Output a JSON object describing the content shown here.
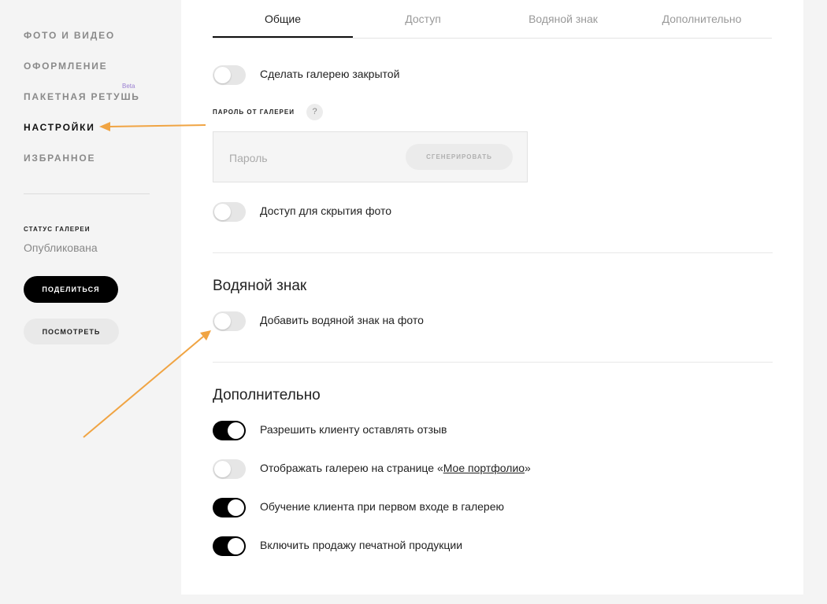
{
  "sidebar": {
    "items": [
      {
        "label": "ФОТО И ВИДЕО"
      },
      {
        "label": "ОФОРМЛЕНИЕ"
      },
      {
        "label": "ПАКЕТНАЯ РЕТУШЬ"
      },
      {
        "label": "НАСТРОЙКИ"
      },
      {
        "label": "ИЗБРАННОЕ"
      }
    ],
    "beta": "Beta",
    "status_label": "СТАТУС ГАЛЕРЕИ",
    "status_value": "Опубликована",
    "share_button": "ПОДЕЛИТЬСЯ",
    "view_button": "ПОСМОТРЕТЬ"
  },
  "tabs": [
    {
      "label": "Общие"
    },
    {
      "label": "Доступ"
    },
    {
      "label": "Водяной знак"
    },
    {
      "label": "Дополнительно"
    }
  ],
  "access": {
    "close_gallery": {
      "label": "Сделать галерею закрытой",
      "on": false
    },
    "password_label": "ПАРОЛЬ ОТ ГАЛЕРЕИ",
    "help": "?",
    "password_placeholder": "Пароль",
    "generate_button": "СГЕНЕРИРОВАТЬ",
    "hide_photos": {
      "label": "Доступ для скрытия фото",
      "on": false
    }
  },
  "watermark": {
    "title": "Водяной знак",
    "add_watermark": {
      "label": "Добавить водяной знак на фото",
      "on": false
    }
  },
  "extra": {
    "title": "Дополнительно",
    "review": {
      "label": "Разрешить клиенту оставлять отзыв",
      "on": true
    },
    "portfolio": {
      "label_before": "Отображать галерею на странице «",
      "link": "Мое портфолио",
      "label_after": "»",
      "on": false
    },
    "onboarding": {
      "label": "Обучение клиента при первом входе в галерею",
      "on": true
    },
    "print_sales": {
      "label": "Включить продажу печатной продукции",
      "on": true
    }
  },
  "colors": {
    "arrow": "#f0a443",
    "beta": "#9a7fd1",
    "toggle_on": "#000000",
    "toggle_off": "#e6e6e6"
  }
}
